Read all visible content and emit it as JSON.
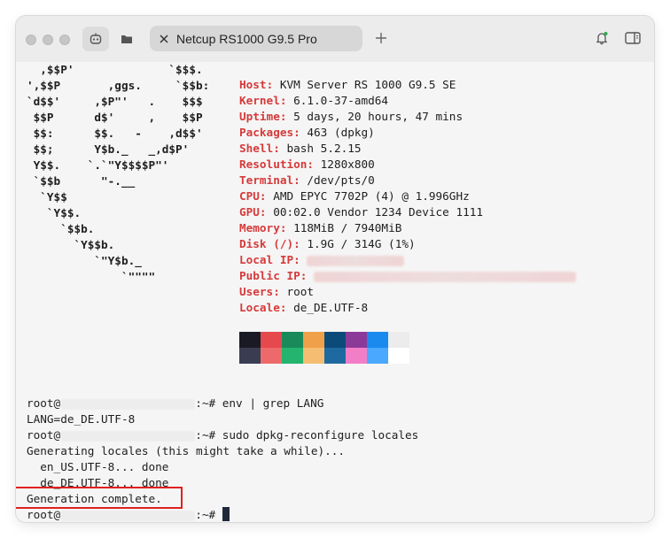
{
  "window": {
    "tab_title": "Netcup RS1000 G9.5 Pro"
  },
  "icons": {
    "close": "close-icon",
    "plus": "plus-icon",
    "bell": "bell-icon",
    "sidebar": "sidebar-toggle-icon"
  },
  "logo": [
    "  ,$$P'              `$$$.",
    "',$$P       ,ggs.     `$$b:",
    "`d$$'     ,$P\"'   .    $$$",
    " $$P      d$'     ,    $$P",
    " $$:      $$.   -    ,d$$'",
    " $$;      Y$b._   _,d$P'",
    " Y$$.    `.`\"Y$$$$P\"'",
    " `$$b      \"-.__",
    "  `Y$$",
    "   `Y$$.",
    "     `$$b.",
    "       `Y$$b.",
    "          `\"Y$b._",
    "              `\"\"\"\""
  ],
  "sysinfo": [
    {
      "key": "Host",
      "value": "KVM Server RS 1000 G9.5 SE"
    },
    {
      "key": "Kernel",
      "value": "6.1.0-37-amd64"
    },
    {
      "key": "Uptime",
      "value": "5 days, 20 hours, 47 mins"
    },
    {
      "key": "Packages",
      "value": "463 (dpkg)"
    },
    {
      "key": "Shell",
      "value": "bash 5.2.15"
    },
    {
      "key": "Resolution",
      "value": "1280x800"
    },
    {
      "key": "Terminal",
      "value": "/dev/pts/0"
    },
    {
      "key": "CPU",
      "value": "AMD EPYC 7702P (4) @ 1.996GHz"
    },
    {
      "key": "GPU",
      "value": "00:02.0 Vendor 1234 Device 1111"
    },
    {
      "key": "Memory",
      "value": "118MiB / 7940MiB"
    },
    {
      "key": "Disk (/)",
      "value": "1.9G / 314G (1%)"
    },
    {
      "key": "Local IP",
      "value": ""
    },
    {
      "key": "Public IP",
      "value": ""
    },
    {
      "key": "Users",
      "value": "root"
    },
    {
      "key": "Locale",
      "value": "de_DE.UTF-8"
    }
  ],
  "palette": {
    "row1": [
      "#191a24",
      "#e5484d",
      "#1a8a5a",
      "#f0a048",
      "#0c4a7a",
      "#8c3a9a",
      "#1a8aee",
      "#ececec"
    ],
    "row2": [
      "#3a3d52",
      "#ee6a6a",
      "#24b46e",
      "#f5bd72",
      "#1e6aa0",
      "#f27ec8",
      "#4aa8ff",
      "#ffffff"
    ]
  },
  "terminal": {
    "prompt_user": "root@",
    "prompt_suffix": ":~# ",
    "lines": {
      "cmd1": "env | grep LANG",
      "out1": "LANG=de_DE.UTF-8",
      "cmd2": "sudo dpkg-reconfigure locales",
      "out2": "Generating locales (this might take a while)...",
      "out3": "  en_US.UTF-8... done",
      "out4": "  de_DE.UTF-8... done",
      "out5": "Generation complete."
    }
  }
}
